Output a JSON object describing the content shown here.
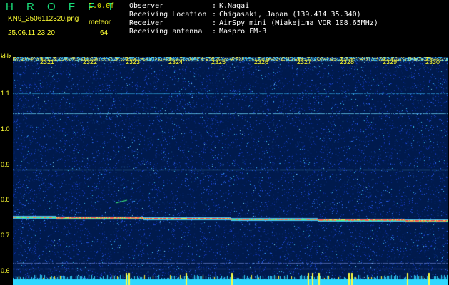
{
  "header": {
    "brand": "H R O F F T",
    "version": "1.0.0f",
    "filename": "KN9_2506112320.png",
    "meteor_label": "meteor",
    "datetime": "25.06.11 23:20",
    "meteor_count": "64",
    "metadata": [
      {
        "key": "Observer",
        "value": "K.Nagai"
      },
      {
        "key": "Receiving Location",
        "value": "Chigasaki, Japan (139.414 35.340)"
      },
      {
        "key": "Receiver",
        "value": "AirSpy mini (Miakejima VOR 108.65MHz)"
      },
      {
        "key": "Receiving antenna",
        "value": "Maspro FM-3"
      }
    ]
  },
  "spectrogram": {
    "y_axis_unit": "kHz",
    "y_ticks": [
      "1.1",
      "1.0",
      "0.9",
      "0.8",
      "0.7",
      "0.6"
    ],
    "time_ticks": [
      "2321",
      "2322",
      "2323",
      "2324",
      "2325",
      "2326",
      "2327",
      "2328",
      "2329",
      "2330"
    ],
    "colors": {
      "background": "#001a4d",
      "noise_low": "#1a3cc8",
      "noise_high": "#3cc8ff",
      "carrier": "#ff4040",
      "label": "#ffff33",
      "brand": "#19e07a"
    }
  }
}
